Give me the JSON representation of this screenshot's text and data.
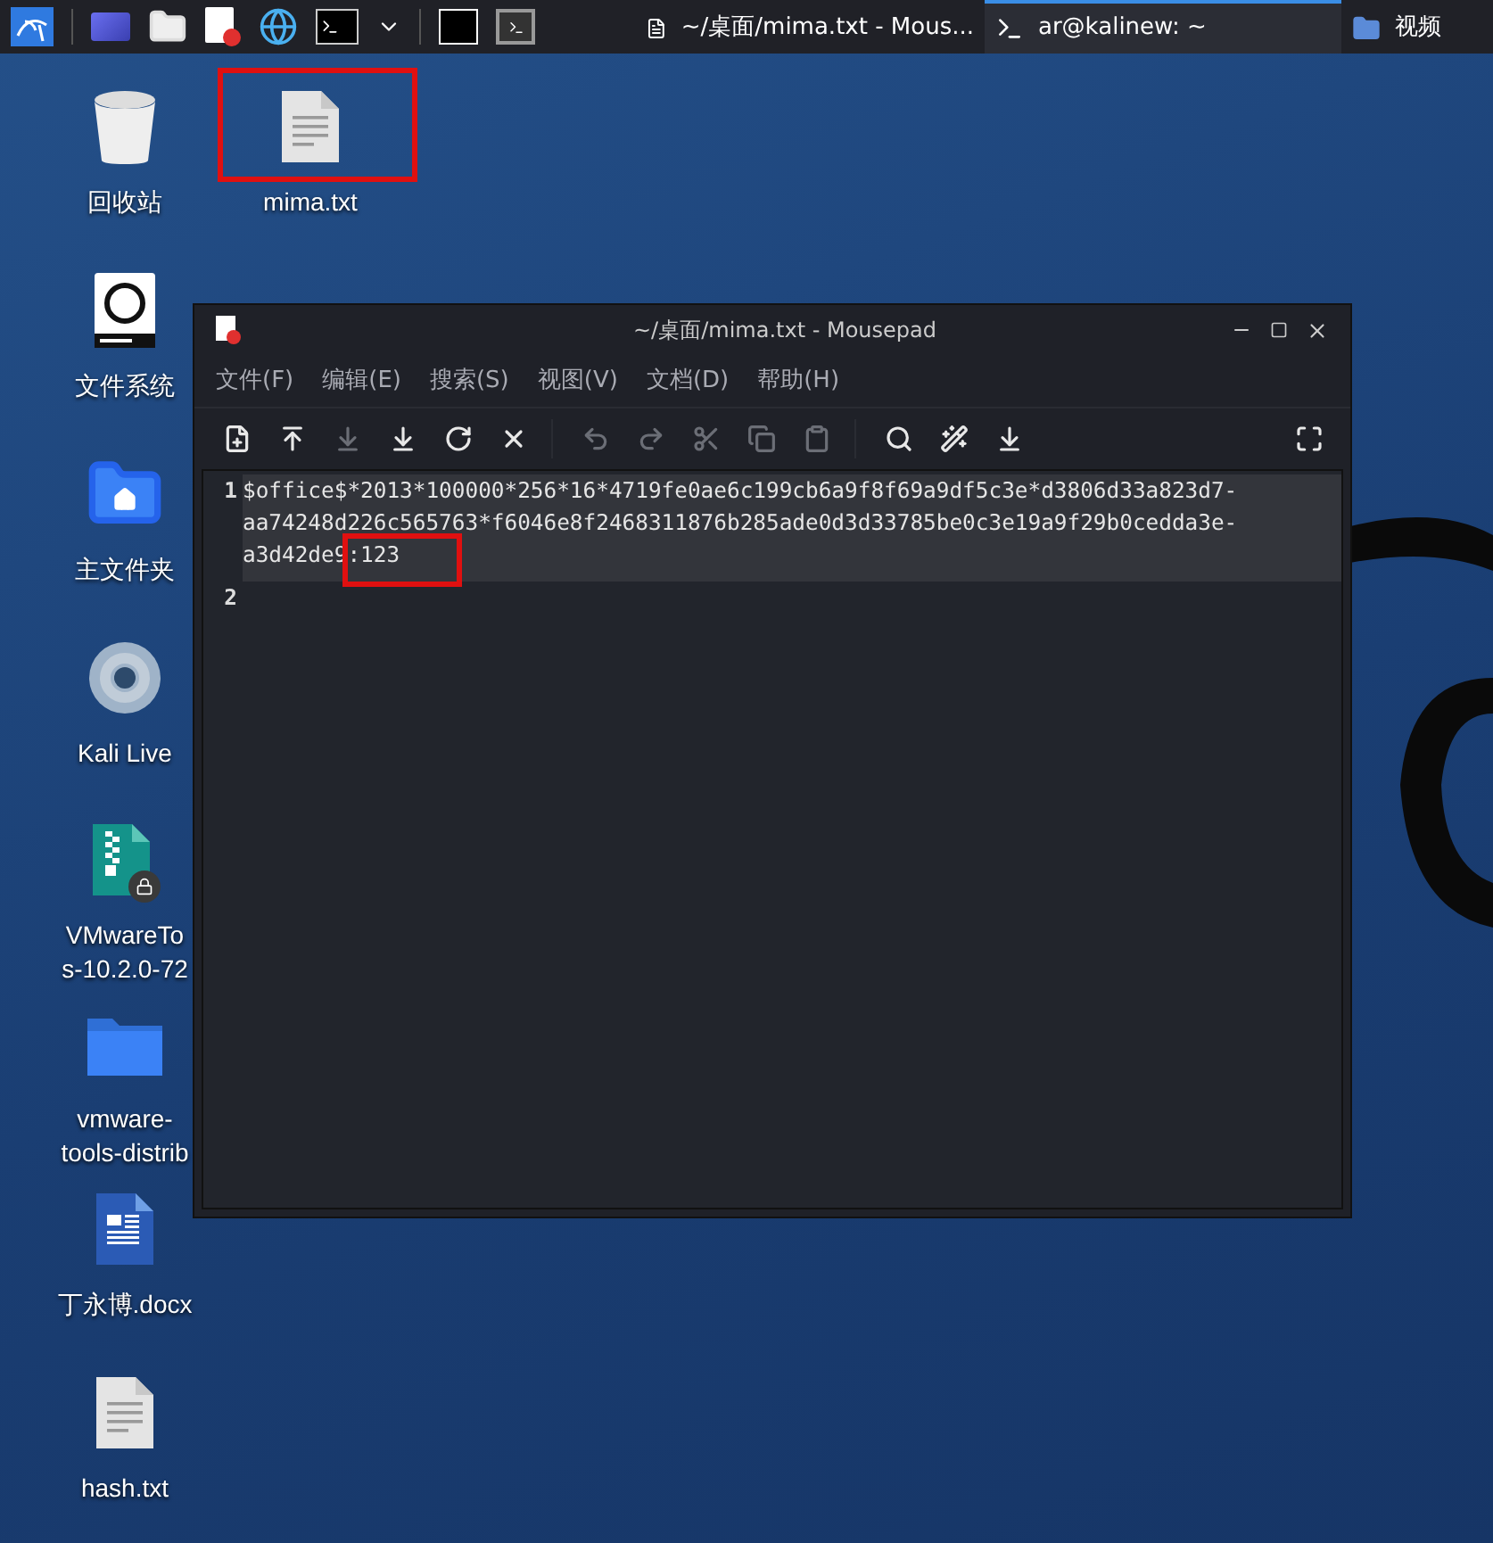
{
  "taskbar": {
    "tasks": [
      {
        "label": "~/桌面/mima.txt - Mous...",
        "selected": false,
        "kind": "editor"
      },
      {
        "label": "ar@kalinew: ~",
        "selected": true,
        "kind": "terminal"
      },
      {
        "label": "视频",
        "selected": false,
        "kind": "folder"
      }
    ]
  },
  "desktop": {
    "icons": [
      {
        "label": [
          "回收站"
        ],
        "kind": "trash",
        "highlighted": false
      },
      {
        "label": [
          "mima.txt"
        ],
        "kind": "text",
        "highlighted": true
      },
      {
        "label": [
          "文件系统"
        ],
        "kind": "drive",
        "highlighted": false
      },
      {
        "label": [
          "主文件夹"
        ],
        "kind": "home",
        "highlighted": false
      },
      {
        "label": [
          "Kali Live"
        ],
        "kind": "disc",
        "highlighted": false
      },
      {
        "label": [
          "VMwareTo",
          "s-10.2.0-72"
        ],
        "kind": "archive",
        "highlighted": false
      },
      {
        "label": [
          "vmware-",
          "tools-distrib"
        ],
        "kind": "folder",
        "highlighted": false
      },
      {
        "label": [
          "丁永博.docx"
        ],
        "kind": "document",
        "highlighted": false
      },
      {
        "label": [
          "hash.txt"
        ],
        "kind": "text",
        "highlighted": false
      }
    ]
  },
  "window": {
    "title": "~/桌面/mima.txt - Mousepad",
    "menu": [
      "文件(F)",
      "编辑(E)",
      "搜索(S)",
      "视图(V)",
      "文档(D)",
      "帮助(H)"
    ],
    "toolbar": {
      "groups": [
        {
          "buttons": [
            {
              "disabled": false
            },
            {
              "disabled": false
            },
            {
              "disabled": true
            },
            {
              "disabled": false
            },
            {
              "disabled": false
            },
            {
              "disabled": false
            }
          ]
        },
        {
          "buttons": [
            {
              "disabled": true
            },
            {
              "disabled": true
            },
            {
              "disabled": true
            },
            {
              "disabled": true
            },
            {
              "disabled": true
            }
          ]
        },
        {
          "buttons": [
            {
              "disabled": false
            },
            {
              "disabled": false
            },
            {
              "disabled": false
            }
          ]
        },
        {
          "buttons": [
            {
              "disabled": false
            }
          ]
        }
      ]
    },
    "lines": [
      {
        "number": "1",
        "current": true,
        "rows": [
          [
            {
              "text": "$office$*2013*100000*256*16*4719fe0ae6c199cb6a9f8f69a9df5c3e*d3806d33a823d7-",
              "highlighted": false
            }
          ],
          [
            {
              "text": "aa74248d226c565763*f6046e8f2468311876b285ade0d3d33785be0c3e19a9f29b0cedda3e-",
              "highlighted": false
            }
          ],
          [
            {
              "text": "a3d42de9",
              "highlighted": false
            },
            {
              "text": ":123",
              "highlighted": true
            }
          ]
        ]
      },
      {
        "number": "2",
        "current": false
      }
    ]
  }
}
